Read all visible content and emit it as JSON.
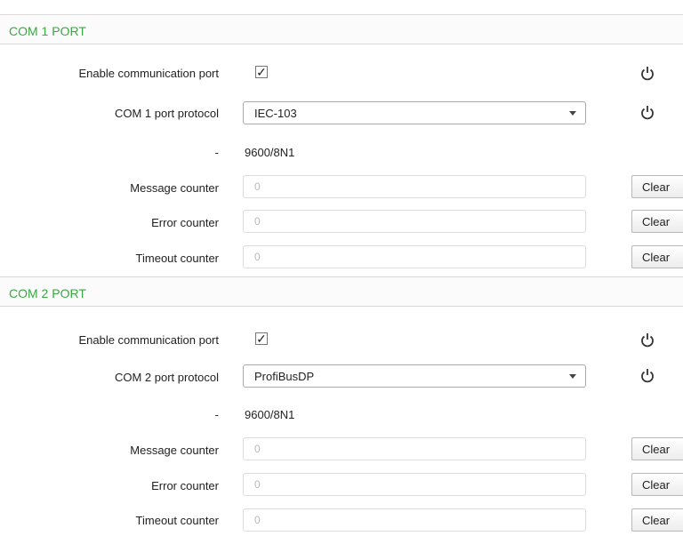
{
  "com1": {
    "title": "COM 1 PORT",
    "enable_label": "Enable communication port",
    "enable_checked": true,
    "protocol_label": "COM 1 port protocol",
    "protocol_value": "IEC-103",
    "settings_label": "-",
    "settings_value": "9600/8N1",
    "message_label": "Message counter",
    "message_value": "0",
    "error_label": "Error counter",
    "error_value": "0",
    "timeout_label": "Timeout counter",
    "timeout_value": "0",
    "clear_label": "Clear"
  },
  "com2": {
    "title": "COM 2 PORT",
    "enable_label": "Enable communication port",
    "enable_checked": true,
    "protocol_label": "COM 2 port protocol",
    "protocol_value": "ProfiBusDP",
    "settings_label": "-",
    "settings_value": "9600/8N1",
    "message_label": "Message counter",
    "message_value": "0",
    "error_label": "Error counter",
    "error_value": "0",
    "timeout_label": "Timeout counter",
    "timeout_value": "0",
    "clear_label": "Clear"
  },
  "icons": {
    "checkmark": "✓",
    "reset": "power-restart-icon"
  },
  "colors": {
    "section_title": "#3aa843"
  }
}
